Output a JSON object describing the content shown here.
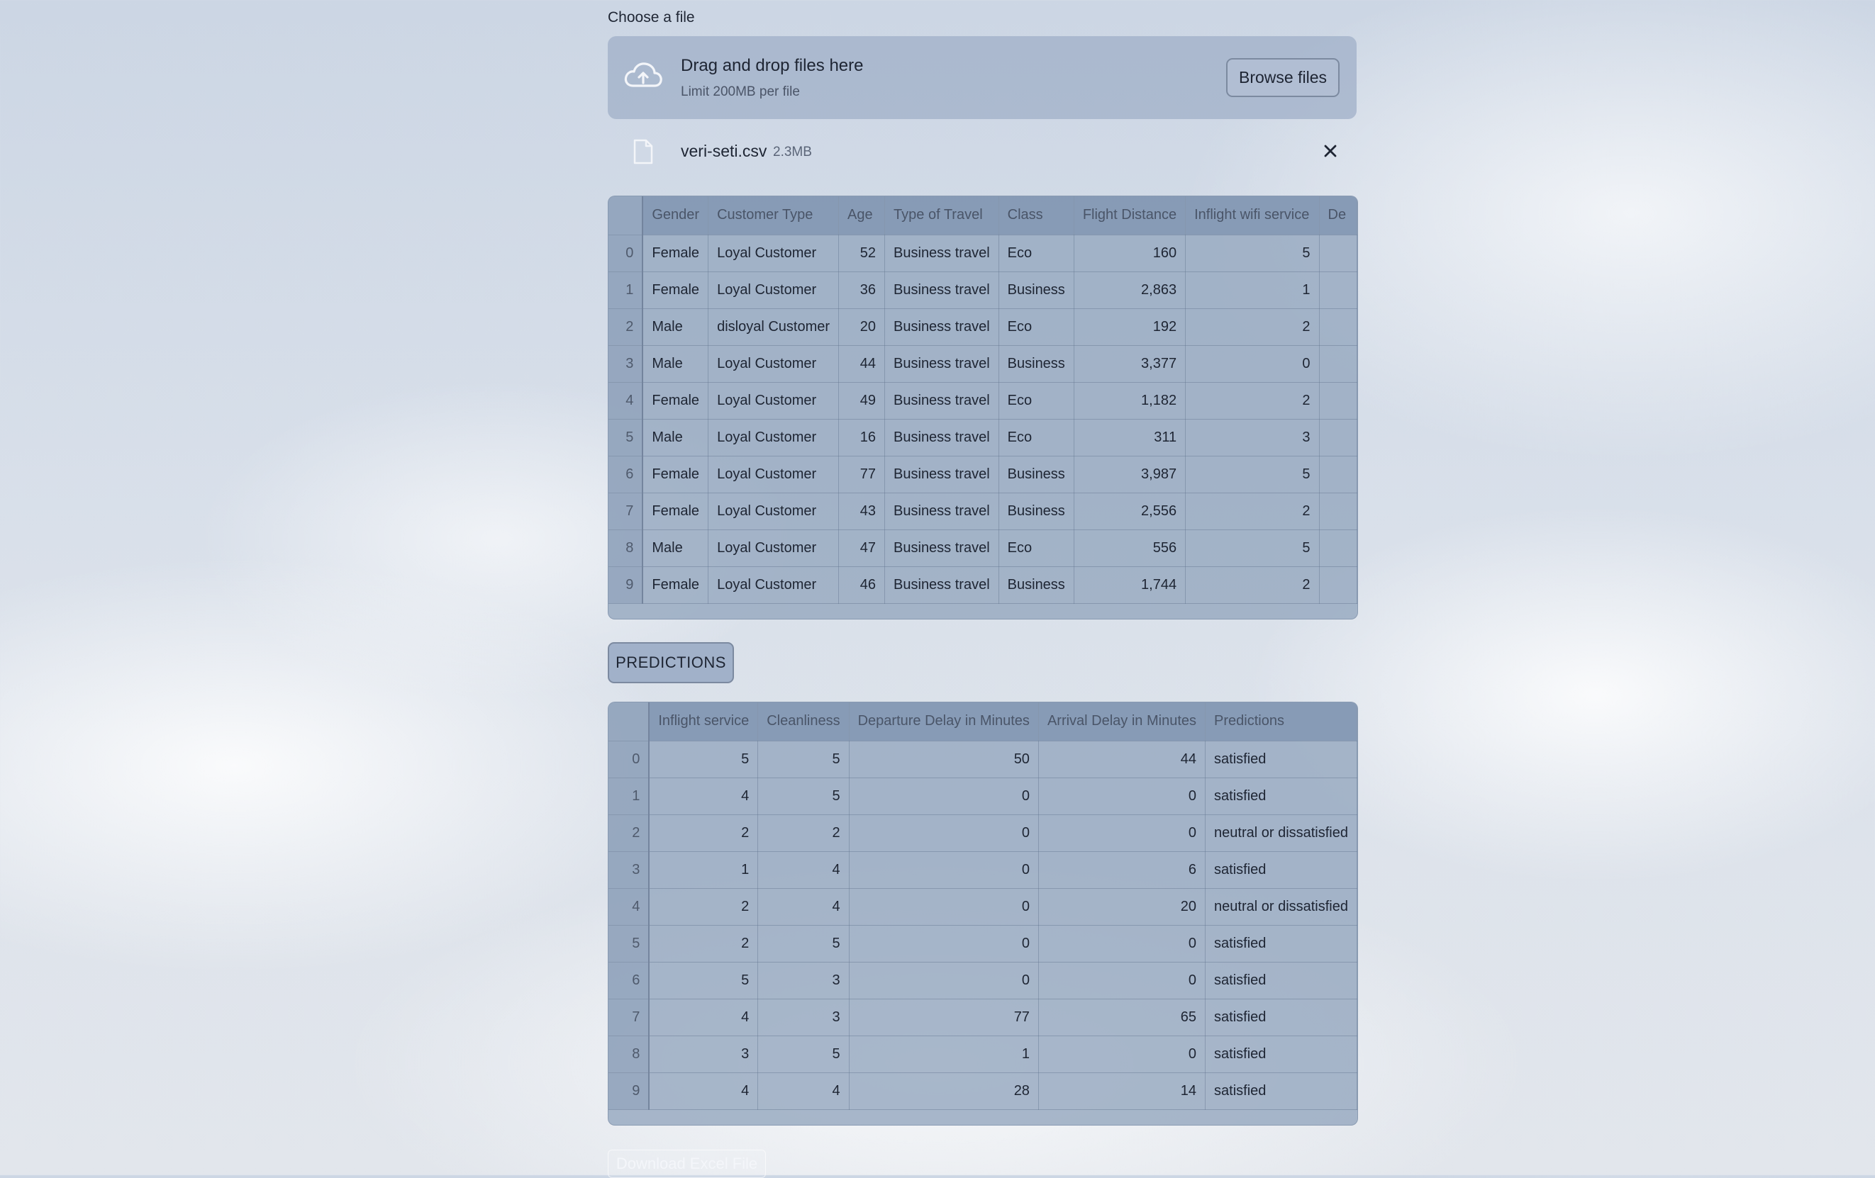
{
  "uploader": {
    "label": "Choose a file",
    "drop_title": "Drag and drop files here",
    "limit_text": "Limit 200MB per file",
    "browse_label": "Browse files"
  },
  "uploaded_file": {
    "name": "veri-seti.csv",
    "size": "2.3MB"
  },
  "data_table": {
    "columns": [
      "",
      "Gender",
      "Customer Type",
      "Age",
      "Type of Travel",
      "Class",
      "Flight Distance",
      "Inflight wifi service",
      "De"
    ],
    "rows": [
      [
        "0",
        "Female",
        "Loyal Customer",
        "52",
        "Business travel",
        "Eco",
        "160",
        "5",
        ""
      ],
      [
        "1",
        "Female",
        "Loyal Customer",
        "36",
        "Business travel",
        "Business",
        "2,863",
        "1",
        ""
      ],
      [
        "2",
        "Male",
        "disloyal Customer",
        "20",
        "Business travel",
        "Eco",
        "192",
        "2",
        ""
      ],
      [
        "3",
        "Male",
        "Loyal Customer",
        "44",
        "Business travel",
        "Business",
        "3,377",
        "0",
        ""
      ],
      [
        "4",
        "Female",
        "Loyal Customer",
        "49",
        "Business travel",
        "Eco",
        "1,182",
        "2",
        ""
      ],
      [
        "5",
        "Male",
        "Loyal Customer",
        "16",
        "Business travel",
        "Eco",
        "311",
        "3",
        ""
      ],
      [
        "6",
        "Female",
        "Loyal Customer",
        "77",
        "Business travel",
        "Business",
        "3,987",
        "5",
        ""
      ],
      [
        "7",
        "Female",
        "Loyal Customer",
        "43",
        "Business travel",
        "Business",
        "2,556",
        "2",
        ""
      ],
      [
        "8",
        "Male",
        "Loyal Customer",
        "47",
        "Business travel",
        "Eco",
        "556",
        "5",
        ""
      ],
      [
        "9",
        "Female",
        "Loyal Customer",
        "46",
        "Business travel",
        "Business",
        "1,744",
        "2",
        ""
      ]
    ]
  },
  "predictions_button": "PREDICTIONS",
  "predictions_table": {
    "columns": [
      "",
      "Inflight service",
      "Cleanliness",
      "Departure Delay in Minutes",
      "Arrival Delay in Minutes",
      "Predictions"
    ],
    "rows": [
      [
        "0",
        "5",
        "5",
        "50",
        "44",
        "satisfied"
      ],
      [
        "1",
        "4",
        "5",
        "0",
        "0",
        "satisfied"
      ],
      [
        "2",
        "2",
        "2",
        "0",
        "0",
        "neutral or dissatisfied"
      ],
      [
        "3",
        "1",
        "4",
        "0",
        "6",
        "satisfied"
      ],
      [
        "4",
        "2",
        "4",
        "0",
        "20",
        "neutral or dissatisfied"
      ],
      [
        "5",
        "2",
        "5",
        "0",
        "0",
        "satisfied"
      ],
      [
        "6",
        "5",
        "3",
        "0",
        "0",
        "satisfied"
      ],
      [
        "7",
        "4",
        "3",
        "77",
        "65",
        "satisfied"
      ],
      [
        "8",
        "3",
        "5",
        "1",
        "0",
        "satisfied"
      ],
      [
        "9",
        "4",
        "4",
        "28",
        "14",
        "satisfied"
      ]
    ]
  },
  "download_button": "Download Excel File"
}
